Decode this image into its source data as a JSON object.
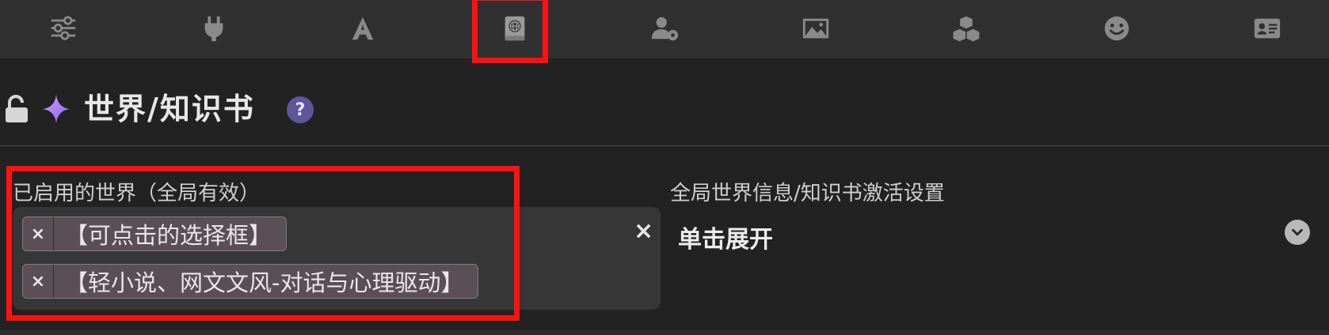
{
  "toolbar": {
    "icons": [
      {
        "name": "sliders-icon"
      },
      {
        "name": "plug-icon"
      },
      {
        "name": "font-icon"
      },
      {
        "name": "world-book-icon"
      },
      {
        "name": "user-gear-icon"
      },
      {
        "name": "image-icon"
      },
      {
        "name": "cubes-icon"
      },
      {
        "name": "smile-icon"
      },
      {
        "name": "id-card-icon"
      }
    ],
    "active": "world-book-icon"
  },
  "header": {
    "title": "世界/知识书",
    "help": "?"
  },
  "active_worlds": {
    "label": "已启用的世界（全局有效）",
    "clear_symbol": "×",
    "tags": [
      {
        "remove": "×",
        "text": "【可点击的选择框】"
      },
      {
        "remove": "×",
        "text": "【轻小说、网文文风-对话与心理驱动】"
      }
    ]
  },
  "global_settings": {
    "label": "全局世界信息/知识书激活设置",
    "toggle_text": "单击展开"
  },
  "colors": {
    "highlight": "#ff1111",
    "accent": "#5f559a",
    "tag_bg": "#5a4f55"
  }
}
